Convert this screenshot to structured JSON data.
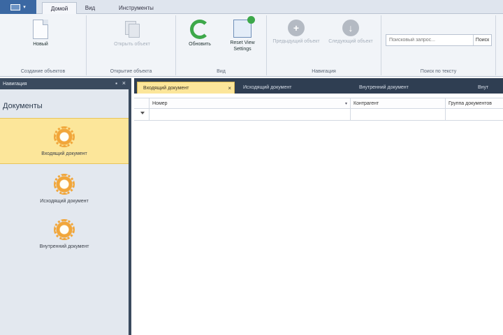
{
  "app": {
    "menu_caret": "▾"
  },
  "ribbon_tabs": [
    "Домой",
    "Вид",
    "Инструменты"
  ],
  "ribbon": {
    "groups": [
      {
        "label": "Создание объектов"
      },
      {
        "label": "Открытие объекта"
      },
      {
        "label": "Вид"
      },
      {
        "label": "Навигация"
      },
      {
        "label": "Поиск по тексту"
      }
    ],
    "buttons": {
      "new": "Новый",
      "open": "Открыть объект",
      "refresh": "Обновить",
      "reset": "Reset View Settings",
      "prev": "Предыдущий объект",
      "next": "Следующий объект"
    },
    "search": {
      "placeholder": "Поисковый запрос...",
      "go_label": "Поиск"
    }
  },
  "nav": {
    "title": "Навигация",
    "pin_glyph": "▪",
    "close_glyph": "×",
    "group": "Документы",
    "items": [
      {
        "label": "Входящий документ",
        "selected": true
      },
      {
        "label": "Исходящий документ",
        "selected": false
      },
      {
        "label": "Внутренний документ",
        "selected": false
      }
    ]
  },
  "doc_tabs": [
    {
      "label": "Входящий документ",
      "active": true,
      "close": "×"
    },
    {
      "label": "Исходящий документ",
      "active": false
    },
    {
      "label": "Внутренний документ",
      "active": false
    },
    {
      "label": "Внут",
      "active": false
    }
  ],
  "grid": {
    "columns": [
      {
        "label": "Номер",
        "sort": "▾"
      },
      {
        "label": "Контрагент"
      },
      {
        "label": "Группа документов"
      }
    ]
  },
  "colors": {
    "selection": "#fce69a",
    "dark_header": "#3a4a5e",
    "ribbon_bg": "#f1f4f8",
    "accent_green": "#3da84a",
    "icon_orange": "#f1a63a"
  },
  "icons": [
    "app-menu-icon",
    "new-document-icon",
    "open-object-icon",
    "refresh-icon",
    "reset-view-icon",
    "previous-object-icon",
    "next-object-icon",
    "gear-icon",
    "filter-icon",
    "close-icon",
    "pin-icon"
  ]
}
